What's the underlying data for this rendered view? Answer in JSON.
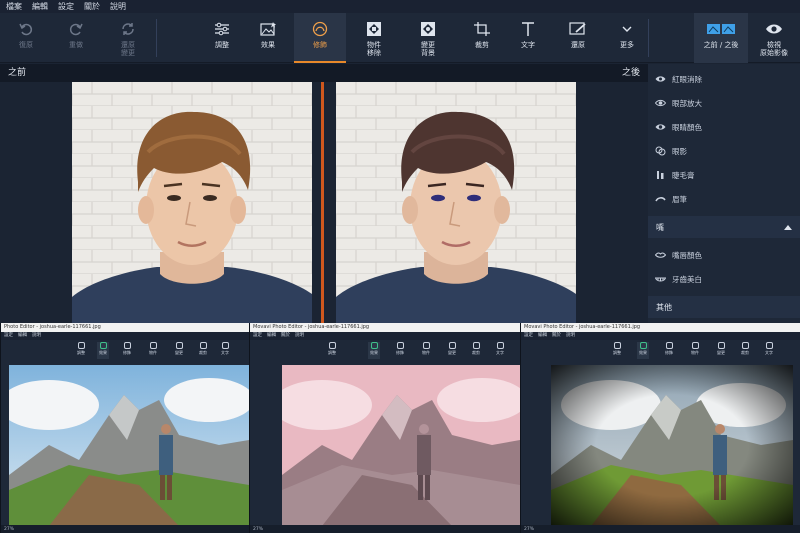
{
  "menu": [
    "檔案",
    "編輯",
    "設定",
    "關於",
    "說明"
  ],
  "toolbar": {
    "undo": "復原",
    "redo": "重做",
    "restore": "還原\n變更",
    "adjust": "調整",
    "effects": "效果",
    "retouch": "修飾",
    "object_remove": "物件\n移除",
    "change_bg": "變更\n背景",
    "crop": "裁剪",
    "text": "文字",
    "restore_tool": "還原",
    "more": "更多",
    "before_after": "之前 / 之後",
    "view_original": "檢視\n原始影像"
  },
  "compare": {
    "before": "之前",
    "after": "之後"
  },
  "panel": {
    "items_eyes": [
      "紅眼消除",
      "眼部放大",
      "眼睛顏色",
      "眼影",
      "睫毛膏",
      "眉筆"
    ],
    "section_mouth": "嘴",
    "items_mouth": [
      "嘴唇顏色",
      "牙齒美白"
    ],
    "section_other": "其他"
  },
  "mini_windows": [
    {
      "title": "Photo Editor - joshua-earle-117661.jpg",
      "menu": [
        "設定",
        "編輯",
        "說明"
      ],
      "zoom": "27%",
      "filter": "normal"
    },
    {
      "title": "Movavi Photo Editor - joshua-earle-117661.jpg",
      "menu": [
        "設定",
        "編輯",
        "關於",
        "說明"
      ],
      "zoom": "27%",
      "filter": "pink"
    },
    {
      "title": "Movavi Photo Editor - joshua-earle-117661.jpg",
      "menu": [
        "設定",
        "編輯",
        "關於",
        "說明"
      ],
      "zoom": "27%",
      "filter": "vignette"
    }
  ],
  "mini_tool_labels": [
    "調整",
    "效果",
    "修飾",
    "物件",
    "變更",
    "裁剪",
    "文字"
  ],
  "colors": {
    "accent": "#e8892a",
    "active_green": "#3fbf8a",
    "divider": "#d0581e",
    "bg": "#1b2433"
  }
}
